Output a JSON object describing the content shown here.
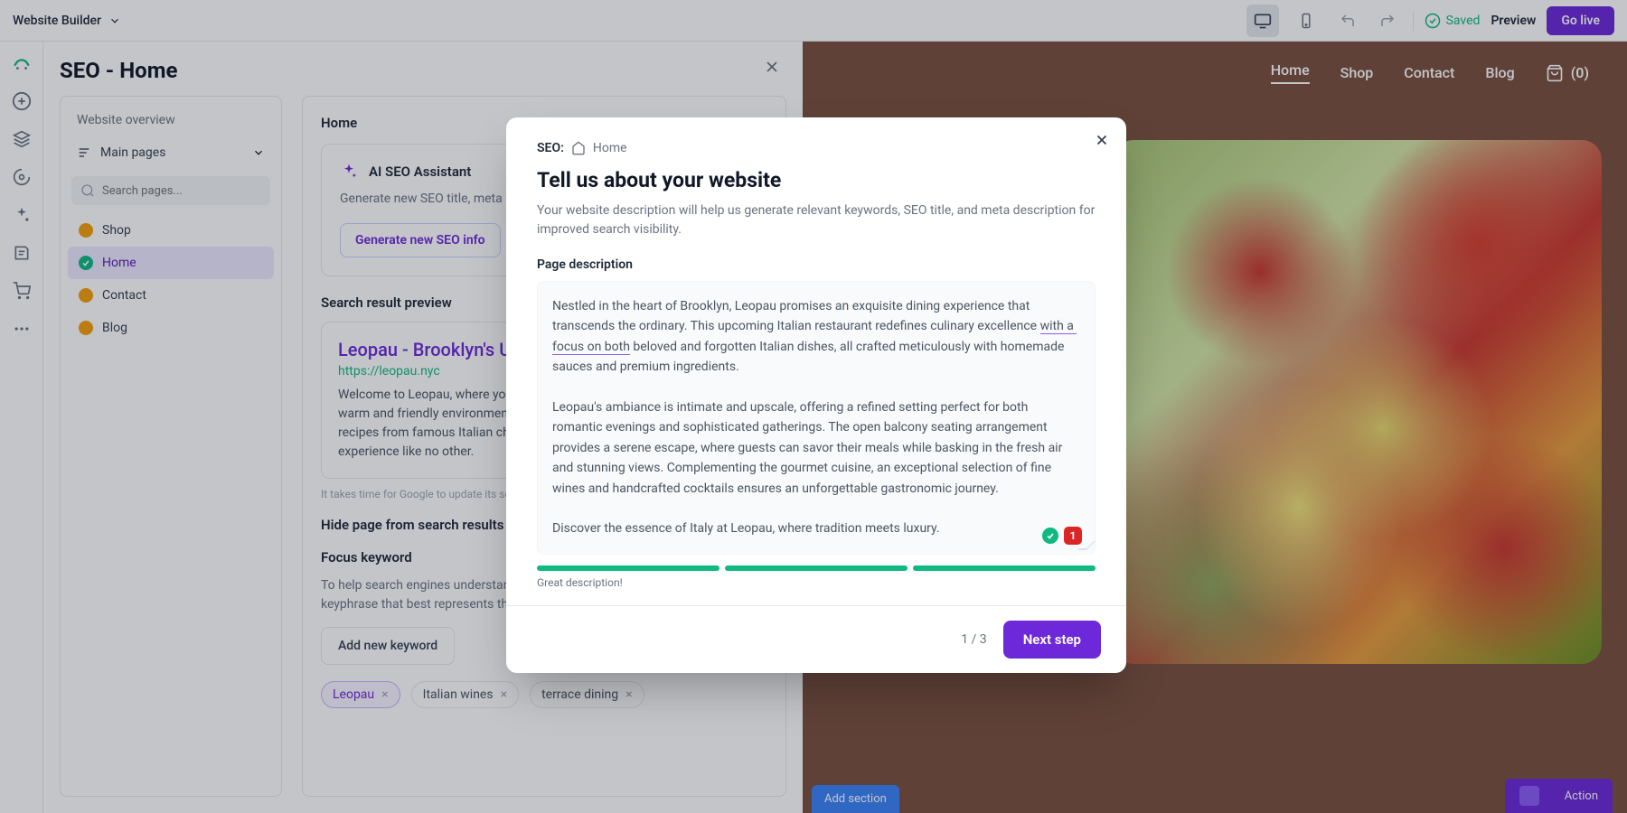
{
  "topbar": {
    "app_name": "Website Builder",
    "saved_label": "Saved",
    "preview_label": "Preview",
    "golive_label": "Go live"
  },
  "panel": {
    "title": "SEO - Home",
    "sidebar": {
      "overview_label": "Website overview",
      "main_pages_label": "Main pages",
      "search_placeholder": "Search pages...",
      "pages": [
        {
          "label": "Shop",
          "status": "amber"
        },
        {
          "label": "Home",
          "status": "green",
          "active": true
        },
        {
          "label": "Contact",
          "status": "amber"
        },
        {
          "label": "Blog",
          "status": "amber"
        }
      ]
    },
    "content": {
      "page_heading": "Home",
      "assistant": {
        "title": "AI SEO Assistant",
        "desc": "Generate new SEO title, meta description, and keywords for your page",
        "button": "Generate new SEO info"
      },
      "serp_heading": "Search result preview",
      "serp": {
        "title": "Leopau - Brooklyn's Upcoming Italian Restaurant",
        "url": "https://leopau.nyc",
        "desc": "Welcome to Leopau, where you can enjoy authentic Italian cuisine in a warm and friendly environment. We use only the freshest ingredients and recipes from famous Italian chefs to deliver an unforgettable culinary experience like no other."
      },
      "serp_hint": "It takes time for Google to update its search results.",
      "hide_heading": "Hide page from search results",
      "keyword_heading": "Focus keyword",
      "keyword_desc": "To help search engines understand your page, add a focus keyword or keyphrase that best represents the topic of this page",
      "add_keyword_btn": "Add new keyword",
      "keywords": [
        {
          "label": "Leopau",
          "primary": true
        },
        {
          "label": "Italian wines"
        },
        {
          "label": "terrace dining"
        }
      ]
    }
  },
  "site": {
    "nav": [
      "Home",
      "Shop",
      "Contact",
      "Blog"
    ],
    "cart_count": "(0)",
    "add_section": "Add section",
    "action_label": "Action"
  },
  "modal": {
    "crumb_prefix": "SEO:",
    "crumb_page": "Home",
    "title": "Tell us about your website",
    "subtitle": "Your website description will help us generate relevant keywords, SEO title, and meta description for improved search visibility.",
    "field_label": "Page description",
    "text_p1a": "Nestled in the heart of Brooklyn, Leopau promises an exquisite dining experience that transcends the ordinary. This upcoming Italian restaurant redefines culinary excellence ",
    "text_under": "with a focus on both",
    "text_p1b": " beloved and forgotten Italian dishes, all crafted meticulously with homemade sauces and premium ingredients.",
    "text_p2": "Leopau's ambiance is intimate and upscale, offering a refined setting perfect for both romantic evenings and sophisticated gatherings. The open balcony seating arrangement provides a serene escape, where guests can savor their meals while basking in the fresh air and stunning views. Complementing the gourmet cuisine, an exceptional selection of fine wines and handcrafted cocktails ensures an unforgettable gastronomic journey.",
    "text_p3": "Discover the essence of Italy at Leopau, where tradition meets luxury.",
    "badge_count": "1",
    "progress_label": "Great description!",
    "step": "1 / 3",
    "next": "Next step"
  }
}
